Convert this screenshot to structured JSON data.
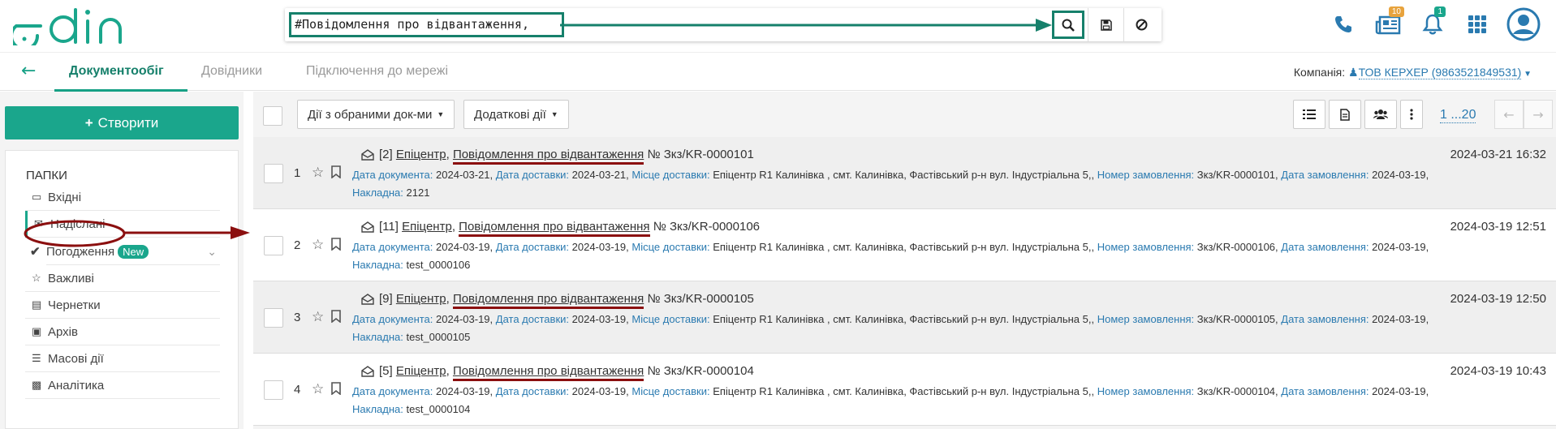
{
  "app": {
    "logo_text": "edin"
  },
  "search": {
    "value": "#Повідомлення про відвантаження,"
  },
  "top_badges": {
    "news": "10",
    "notifications": "1"
  },
  "nav": {
    "back": "←",
    "tabs": [
      {
        "label": "Документообіг"
      },
      {
        "label": "Довідники"
      },
      {
        "label": "Підключення до мережі"
      }
    ],
    "company_label": "Компанія:",
    "company_value": "ТОВ КЕРХЕР (9863521849531)"
  },
  "sidebar": {
    "create_label": "Створити",
    "folders_title": "ПАПКИ",
    "items": [
      {
        "label": "Вхідні",
        "icon": "inbox-icon"
      },
      {
        "label": "Надіслані",
        "icon": "envelope-icon"
      },
      {
        "label": "Погодження",
        "icon": "check-icon",
        "badge": "New"
      },
      {
        "label": "Важливі",
        "icon": "star-icon"
      },
      {
        "label": "Чернетки",
        "icon": "draft-icon"
      },
      {
        "label": "Архів",
        "icon": "archive-icon"
      },
      {
        "label": "Масові дії",
        "icon": "bulk-icon"
      },
      {
        "label": "Аналітика",
        "icon": "chart-icon"
      }
    ]
  },
  "toolbar": {
    "actions_label": "Дії з обраними док-ми",
    "extra_label": "Додаткові дії",
    "pager": "1 ...20"
  },
  "labels": {
    "doc_date": "Дата документа:",
    "delivery_date": "Дата доставки:",
    "delivery_place": "Місце доставки:",
    "order_no": "Номер замовлення:",
    "order_date": "Дата замовлення:",
    "invoice": "Накладна:"
  },
  "rows": [
    {
      "num": "1",
      "count": "[2]",
      "partner": "Епіцентр",
      "doctype": "Повідомлення про відвантаження",
      "number": "№ Зкз/KR-0000101",
      "datetime": "2024-03-21 16:32",
      "doc_date": "2024-03-21,",
      "delivery_date": "2024-03-21,",
      "place": "Епіцентр R1 Калинівка , смт. Калинівка, Фастівський р-н вул. Індустріальна 5,,",
      "order_no": "Зкз/KR-0000101,",
      "order_date": "2024-03-19,",
      "invoice": "2121"
    },
    {
      "num": "2",
      "count": "[11]",
      "partner": "Епіцентр",
      "doctype": "Повідомлення про відвантаження",
      "number": "№ Зкз/KR-0000106",
      "datetime": "2024-03-19 12:51",
      "doc_date": "2024-03-19,",
      "delivery_date": "2024-03-19,",
      "place": "Епіцентр R1 Калинівка , смт. Калинівка, Фастівський р-н вул. Індустріальна 5,,",
      "order_no": "Зкз/KR-0000106,",
      "order_date": "2024-03-19,",
      "invoice": "test_0000106"
    },
    {
      "num": "3",
      "count": "[9]",
      "partner": "Епіцентр",
      "doctype": "Повідомлення про відвантаження",
      "number": "№ Зкз/KR-0000105",
      "datetime": "2024-03-19 12:50",
      "doc_date": "2024-03-19,",
      "delivery_date": "2024-03-19,",
      "place": "Епіцентр R1 Калинівка , смт. Калинівка, Фастівський р-н вул. Індустріальна 5,,",
      "order_no": "Зкз/KR-0000105,",
      "order_date": "2024-03-19,",
      "invoice": "test_0000105"
    },
    {
      "num": "4",
      "count": "[5]",
      "partner": "Епіцентр",
      "doctype": "Повідомлення про відвантаження",
      "number": "№ Зкз/KR-0000104",
      "datetime": "2024-03-19 10:43",
      "doc_date": "2024-03-19,",
      "delivery_date": "2024-03-19,",
      "place": "Епіцентр R1 Калинівка , смт. Калинівка, Фастівський р-н вул. Індустріальна 5,,",
      "order_no": "Зкз/KR-0000104,",
      "order_date": "2024-03-19,",
      "invoice": "test_0000104"
    }
  ],
  "colors": {
    "brand": "#1aa68c",
    "highlight_green": "#16806b",
    "annotation_red": "#8b0f0f",
    "link": "#2a7ab0"
  }
}
